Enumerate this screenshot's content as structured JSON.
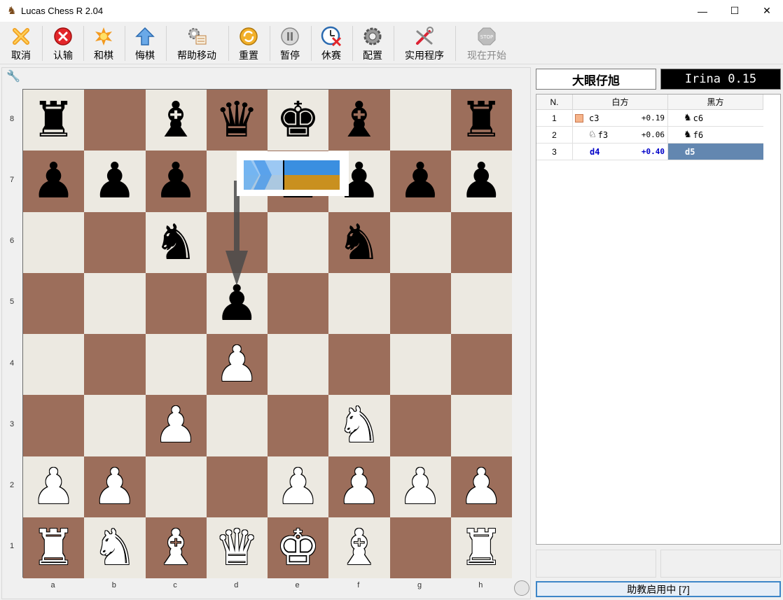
{
  "window": {
    "title": "Lucas Chess R 2.04",
    "minimize_glyph": "—",
    "maximize_glyph": "☐",
    "close_glyph": "✕"
  },
  "toolbar": {
    "items": [
      {
        "label": "取消",
        "icon": "cancel-x-icon",
        "enabled": true
      },
      {
        "label": "认输",
        "icon": "resign-red-circle-icon",
        "enabled": true
      },
      {
        "label": "和棋",
        "icon": "draw-star-icon",
        "enabled": true
      },
      {
        "label": "悔棋",
        "icon": "takeback-arrow-icon",
        "enabled": true
      },
      {
        "label": "帮助移动",
        "icon": "help-move-gears-icon",
        "enabled": true
      },
      {
        "label": "重置",
        "icon": "reset-cycle-icon",
        "enabled": true
      },
      {
        "label": "暂停",
        "icon": "pause-icon",
        "enabled": true
      },
      {
        "label": "休赛",
        "icon": "adjourn-clock-icon",
        "enabled": true
      },
      {
        "label": "配置",
        "icon": "config-gear-icon",
        "enabled": true
      },
      {
        "label": "实用程序",
        "icon": "utilities-tools-icon",
        "enabled": true
      },
      {
        "label": "现在开始",
        "icon": "stop-sign-icon",
        "enabled": false
      }
    ]
  },
  "board": {
    "ranks": [
      "8",
      "7",
      "6",
      "5",
      "4",
      "3",
      "2",
      "1"
    ],
    "files": [
      "a",
      "b",
      "c",
      "d",
      "e",
      "f",
      "g",
      "h"
    ],
    "fen": "r1bqkb1r/ppp1pppp/2n2n2/3p4/3P4/2P2N2/PP2PPPP/RNBQKB1R",
    "arrow": {
      "from": "d7",
      "to": "d5"
    },
    "colors": {
      "light": "#ece9e1",
      "dark": "#9c6e5b"
    }
  },
  "players": {
    "white": "大眼仔旭",
    "black": "Irina 0.15"
  },
  "moves_table": {
    "headers": {
      "num": "N.",
      "white": "白方",
      "black": "黑方"
    },
    "rows": [
      {
        "num": "1",
        "white_piece": "",
        "white": "c3",
        "white_eval": "+0.19",
        "black_piece": "♞",
        "black": "c6"
      },
      {
        "num": "2",
        "white_piece": "♘",
        "white": "f3",
        "white_eval": "+0.06",
        "black_piece": "♞",
        "black": "f6"
      },
      {
        "num": "3",
        "white_piece": "",
        "white": "d4",
        "white_eval": "+0.40",
        "black_piece": "",
        "black": "d5"
      }
    ]
  },
  "status": {
    "tutor": "助教启用中 [7]"
  }
}
